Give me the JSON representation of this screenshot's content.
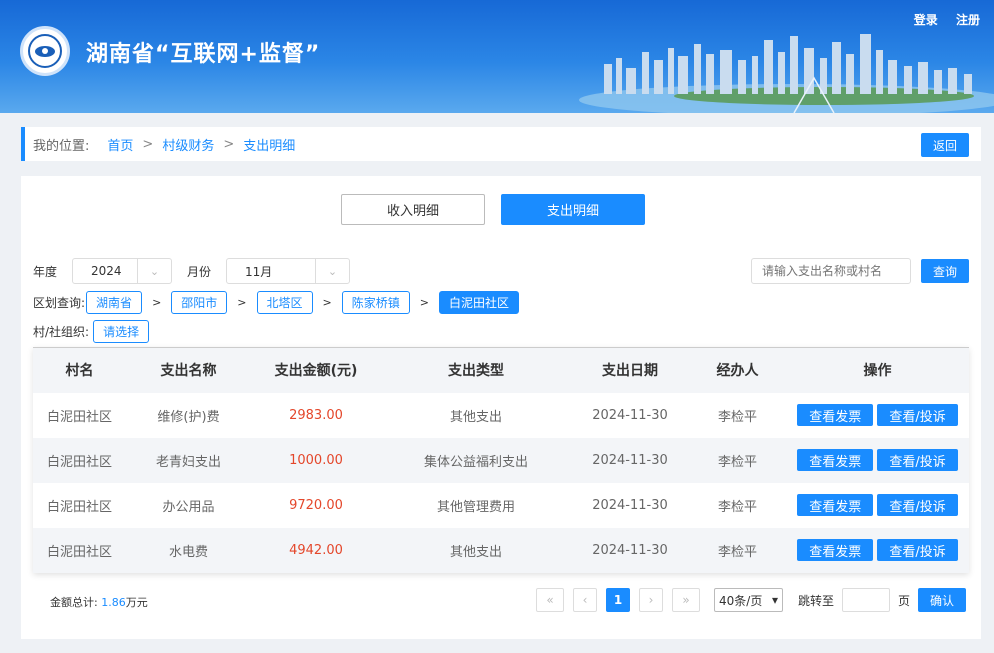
{
  "header": {
    "title": "湖南省“互联网+监督”",
    "login": "登录",
    "register": "注册"
  },
  "breadcrumb": {
    "label": "我的位置:",
    "items": [
      "首页",
      "村级财务",
      "支出明细"
    ],
    "back": "返回"
  },
  "tabs": [
    {
      "label": "收入明细",
      "active": false
    },
    {
      "label": "支出明细",
      "active": true
    }
  ],
  "filters": {
    "year_label": "年度",
    "year_value": "2024",
    "month_label": "月份",
    "month_value": "11月",
    "search_placeholder": "请输入支出名称或村名",
    "query": "查询",
    "region_label": "区划查询:",
    "regions": [
      "湖南省",
      "邵阳市",
      "北塔区",
      "陈家桥镇",
      "白泥田社区"
    ],
    "org_label": "村/社组织:",
    "org_value": "请选择"
  },
  "table": {
    "columns": [
      "村名",
      "支出名称",
      "支出金额(元)",
      "支出类型",
      "支出日期",
      "经办人",
      "操作"
    ],
    "rows": [
      {
        "village": "白泥田社区",
        "name": "维修(护)费",
        "amount": "2983.00",
        "type": "其他支出",
        "date": "2024-11-30",
        "handler": "李检平"
      },
      {
        "village": "白泥田社区",
        "name": "老青妇支出",
        "amount": "1000.00",
        "type": "集体公益福利支出",
        "date": "2024-11-30",
        "handler": "李检平"
      },
      {
        "village": "白泥田社区",
        "name": "办公用品",
        "amount": "9720.00",
        "type": "其他管理费用",
        "date": "2024-11-30",
        "handler": "李检平"
      },
      {
        "village": "白泥田社区",
        "name": "水电费",
        "amount": "4942.00",
        "type": "其他支出",
        "date": "2024-11-30",
        "handler": "李检平"
      }
    ],
    "op_invoice": "查看发票",
    "op_complaint": "查看/投诉"
  },
  "footer": {
    "total_label": "金额总计:",
    "total_value": "1.86",
    "total_unit": "万元",
    "current_page": "1",
    "page_size": "40条/页",
    "jump_label": "跳转至",
    "page_unit": "页",
    "confirm": "确认"
  },
  "colors": {
    "accent": "#1a8cff",
    "amount": "#e4472b"
  }
}
